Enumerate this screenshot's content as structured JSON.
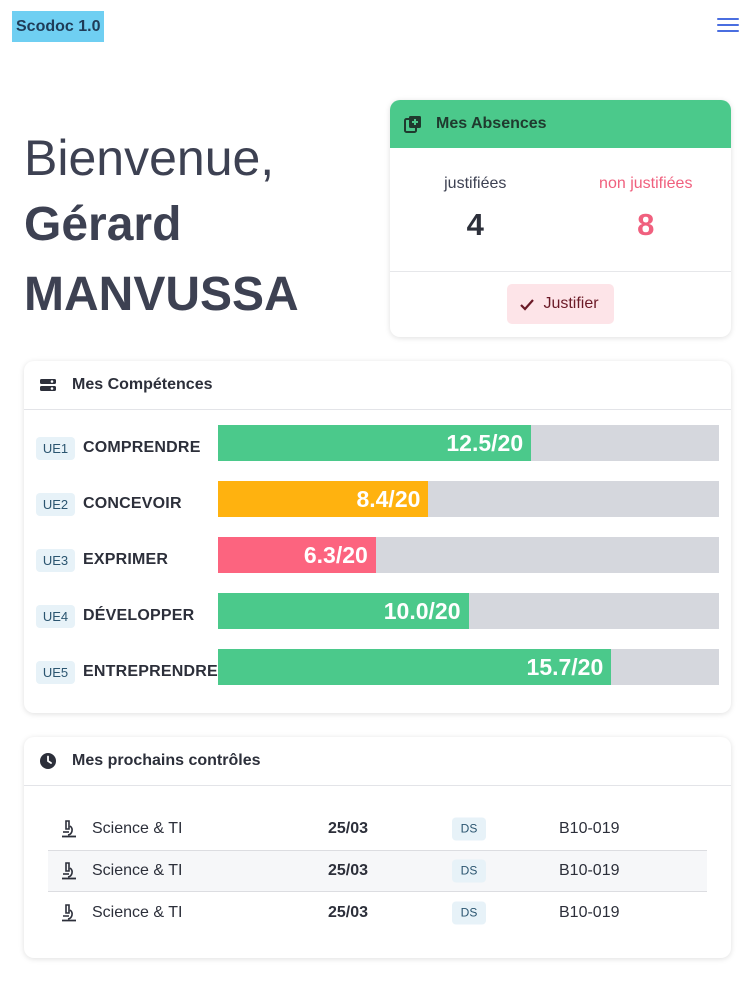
{
  "app": {
    "title": "Scodoc 1.0"
  },
  "header": {
    "menu_icon": "hamburger-menu-icon"
  },
  "welcome": {
    "greeting": "Bienvenue,",
    "first_name": "Gérard",
    "last_name": "MANVUSSA"
  },
  "absences": {
    "title": "Mes Absences",
    "icon": "add-library-icon",
    "justified_label": "justifiées",
    "justified_count": "4",
    "unjustified_label": "non justifiées",
    "unjustified_count": "8",
    "justify_button": "Justifier",
    "colors": {
      "header": "#4bc98b",
      "unjustified": "#f0607e"
    }
  },
  "competences": {
    "title": "Mes Compétences",
    "icon": "toggle-list-icon",
    "max": 20,
    "items": [
      {
        "ue": "UE1",
        "name": "COMPRENDRE",
        "score": 12.5,
        "label": "12.5/20",
        "color": "#4bc98b"
      },
      {
        "ue": "UE2",
        "name": "CONCEVOIR",
        "score": 8.4,
        "label": "8.4/20",
        "color": "#ffb20f"
      },
      {
        "ue": "UE3",
        "name": "EXPRIMER",
        "score": 6.3,
        "label": "6.3/20",
        "color": "#fc647f"
      },
      {
        "ue": "UE4",
        "name": "DÉVELOPPER",
        "score": 10.0,
        "label": "10.0/20",
        "color": "#4bc98b"
      },
      {
        "ue": "UE5",
        "name": "ENTREPRENDRE",
        "score": 15.7,
        "label": "15.7/20",
        "color": "#4bc98b"
      }
    ]
  },
  "controls": {
    "title": "Mes prochains contrôles",
    "icon": "clock-icon",
    "rows": [
      {
        "icon": "microscope-icon",
        "subject": "Science & TI",
        "date": "25/03",
        "type": "DS",
        "room": "B10-019"
      },
      {
        "icon": "microscope-icon",
        "subject": "Science & TI",
        "date": "25/03",
        "type": "DS",
        "room": "B10-019"
      },
      {
        "icon": "microscope-icon",
        "subject": "Science & TI",
        "date": "25/03",
        "type": "DS",
        "room": "B10-019"
      }
    ]
  }
}
